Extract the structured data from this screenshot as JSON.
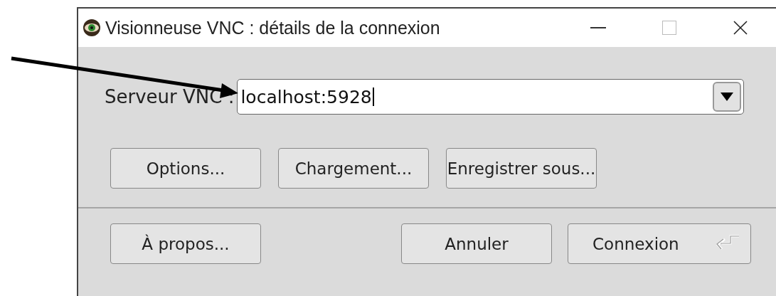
{
  "window": {
    "title": "Visionneuse VNC : détails de la connexion"
  },
  "server": {
    "label": "Serveur VNC :",
    "value": "localhost:5928"
  },
  "buttons_top": [
    {
      "label": "Options..."
    },
    {
      "label": "Chargement..."
    },
    {
      "label": "Enregistrer sous..."
    }
  ],
  "buttons_bottom": [
    {
      "label": "À propos...",
      "kind": "plain"
    },
    {
      "label": "Annuler",
      "kind": "plain"
    },
    {
      "label": "Connexion",
      "kind": "default"
    }
  ]
}
